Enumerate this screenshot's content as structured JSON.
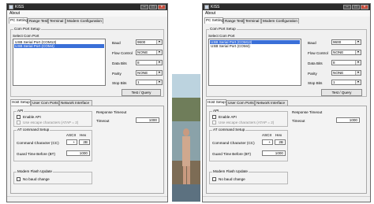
{
  "left_window": {
    "title": "KISS",
    "menu": "About",
    "tabs": [
      "PC Settings",
      "Range Test",
      "Terminal",
      "Modem Configuration"
    ],
    "com_port_setup": {
      "group_title": "Com Port Setup",
      "select_label": "Select Com Port",
      "ports": [
        "USB Serial Port (COM13)",
        "USB Serial Port (COM4)"
      ],
      "selected_port_index": 1,
      "baud_label": "Baud",
      "baud_value": "9600",
      "flow_label": "Flow Control",
      "flow_value": "NONE",
      "databits_label": "Data Bits",
      "databits_value": "8",
      "parity_label": "Parity",
      "parity_value": "NONE",
      "stopbits_label": "Stop Bits",
      "stopbits_value": "1",
      "test_query_label": "Test / Query"
    },
    "host_tabs": [
      "Host Setup",
      "User Com Ports",
      "Network Interface"
    ],
    "api": {
      "title": "API",
      "enable_api": "Enable API",
      "escape_chars": "Use escape characters (ATAP = 2)"
    },
    "at_command": {
      "title": "AT command Setup",
      "ascii_header": "ASCII",
      "hex_header": "Hex",
      "command_char_label": "Command Character (CC)",
      "cc_ascii": "+",
      "cc_hex": "2B",
      "guard_time_label": "Guard Time Before (BT)",
      "guard_time_value": "1000"
    },
    "modem_flash": {
      "title": "Modem Flash Update",
      "no_baud_change": "No baud change"
    },
    "response_timeout": {
      "title": "Response Timeout",
      "timeout_label": "Timeout",
      "timeout_value": "1000"
    }
  },
  "right_window": {
    "title": "KISS",
    "menu": "About",
    "tabs": [
      "PC Settings",
      "Range Test",
      "Terminal",
      "Modem Configuration"
    ],
    "com_port_setup": {
      "group_title": "Com Port Setup",
      "select_label": "Select Com Port",
      "ports": [
        "USB Serial Port (COM13)",
        "USB Serial Port (COM4)"
      ],
      "selected_port_index": 0,
      "baud_label": "Baud",
      "baud_value": "9600",
      "flow_label": "Flow Control",
      "flow_value": "NONE",
      "databits_label": "Data Bits",
      "databits_value": "8",
      "parity_label": "Parity",
      "parity_value": "NONE",
      "stopbits_label": "Stop Bits",
      "stopbits_value": "1",
      "test_query_label": "Test / Query"
    },
    "host_tabs": [
      "Host Setup",
      "User Com Ports",
      "Network Interface"
    ],
    "api": {
      "title": "API",
      "enable_api": "Enable API",
      "escape_chars": "Use escape characters (ATAP = 2)"
    },
    "at_command": {
      "title": "AT command Setup",
      "ascii_header": "ASCII",
      "hex_header": "Hex",
      "command_char_label": "Command Character (CC)",
      "cc_ascii": "+",
      "cc_hex": "2B",
      "guard_time_label": "Guard Time Before (BT)",
      "guard_time_value": "1000"
    },
    "modem_flash": {
      "title": "Modem Flash Update",
      "no_baud_change": "No baud change"
    },
    "response_timeout": {
      "title": "Response Timeout",
      "timeout_label": "Timeout",
      "timeout_value": "1000"
    }
  },
  "colors": {
    "titlebar": "#2b2b2b",
    "selection": "#3a6fd8",
    "close_button": "#c64b3a"
  },
  "icons": [
    "app-icon",
    "minimize-icon",
    "maximize-icon",
    "close-icon",
    "dropdown-arrow-icon"
  ]
}
